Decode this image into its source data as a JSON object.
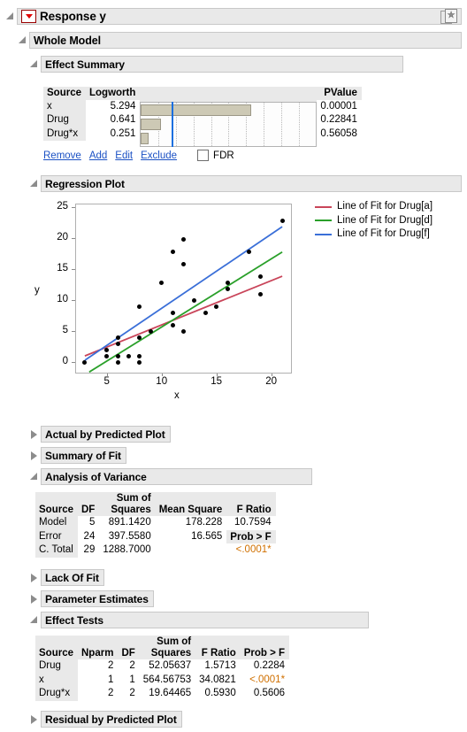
{
  "window": {
    "title": "Response y",
    "menu_icon": "red-triangle-menu-icon",
    "corner_icon": "window-layers-star-icon"
  },
  "sections": {
    "whole_model": "Whole Model",
    "effect_summary": "Effect Summary",
    "regression_plot": "Regression Plot",
    "actual_by_predicted": "Actual by Predicted Plot",
    "summary_of_fit": "Summary of Fit",
    "analysis_of_variance": "Analysis of Variance",
    "lack_of_fit": "Lack Of Fit",
    "parameter_estimates": "Parameter Estimates",
    "effect_tests": "Effect Tests",
    "residual_by_predicted": "Residual by Predicted Plot"
  },
  "effect_summary": {
    "headers": [
      "Source",
      "Logworth",
      "PValue"
    ],
    "rows": [
      {
        "source": "x",
        "logworth": "5.294",
        "pvalue": "0.00001",
        "bar_frac": 0.63
      },
      {
        "source": "Drug",
        "logworth": "0.641",
        "pvalue": "0.22841",
        "bar_frac": 0.115
      },
      {
        "source": "Drug*x",
        "logworth": "0.251",
        "pvalue": "0.56058",
        "bar_frac": 0.045
      }
    ],
    "reference_line_frac": 0.176,
    "links": [
      "Remove",
      "Add",
      "Edit",
      "Exclude"
    ],
    "fdr_label": "FDR",
    "fdr_checked": false,
    "bar_color": "#cdc9b5",
    "ref_color": "#1a6fe0"
  },
  "chart_data": {
    "type": "scatter",
    "title": "Regression Plot",
    "xlabel": "x",
    "ylabel": "y",
    "xlim": [
      2.2,
      21.8
    ],
    "ylim": [
      -1.6,
      25.6
    ],
    "xticks": [
      5,
      10,
      15,
      20
    ],
    "yticks": [
      0,
      5,
      10,
      15,
      20,
      25
    ],
    "grid": false,
    "legend_position": "right",
    "points": [
      [
        3,
        0
      ],
      [
        5,
        2
      ],
      [
        5,
        1
      ],
      [
        6,
        4
      ],
      [
        6,
        3
      ],
      [
        6,
        1
      ],
      [
        6,
        0
      ],
      [
        7,
        1
      ],
      [
        8,
        1
      ],
      [
        8,
        0
      ],
      [
        8,
        4
      ],
      [
        8,
        9
      ],
      [
        9,
        5
      ],
      [
        10,
        13
      ],
      [
        11,
        18
      ],
      [
        11,
        8
      ],
      [
        11,
        6
      ],
      [
        12,
        20
      ],
      [
        12,
        16
      ],
      [
        12,
        5
      ],
      [
        13,
        10
      ],
      [
        14,
        8
      ],
      [
        15,
        9
      ],
      [
        16,
        13
      ],
      [
        16,
        12
      ],
      [
        18,
        18
      ],
      [
        19,
        14
      ],
      [
        19,
        11
      ],
      [
        21,
        23
      ]
    ],
    "series": [
      {
        "name": "Line of Fit for Drug[a]",
        "color": "#c9455a",
        "type": "line",
        "x": [
          3.0,
          21.0
        ],
        "y": [
          1.1,
          14.0
        ]
      },
      {
        "name": "Line of Fit for Drug[d]",
        "color": "#2aa02a",
        "type": "line",
        "x": [
          3.4,
          21.0
        ],
        "y": [
          -1.5,
          17.9
        ]
      },
      {
        "name": "Line of Fit for Drug[f]",
        "color": "#3a6fd8",
        "type": "line",
        "x": [
          3.0,
          21.0
        ],
        "y": [
          0.4,
          22.0
        ]
      }
    ]
  },
  "anova": {
    "headers": [
      "Source",
      "DF",
      "Sum of\nSquares",
      "Mean Square",
      "F Ratio"
    ],
    "rows": [
      {
        "source": "Model",
        "df": "5",
        "ss": "891.1420",
        "ms": "178.228",
        "f": "10.7594",
        "f_orange": false
      },
      {
        "source": "Error",
        "df": "24",
        "ss": "397.5580",
        "ms": "16.565",
        "f": "Prob > F",
        "f_header": true
      },
      {
        "source": "C. Total",
        "df": "29",
        "ss": "1288.7000",
        "ms": "",
        "f": "<.0001*",
        "f_orange": true
      }
    ]
  },
  "effect_tests": {
    "headers": [
      "Source",
      "Nparm",
      "DF",
      "Sum of\nSquares",
      "F Ratio",
      "Prob > F"
    ],
    "rows": [
      {
        "source": "Drug",
        "nparm": "2",
        "df": "2",
        "ss": "52.05637",
        "f": "1.5713",
        "p": "0.2284",
        "p_orange": false
      },
      {
        "source": "x",
        "nparm": "1",
        "df": "1",
        "ss": "564.56753",
        "f": "34.0821",
        "p": "<.0001*",
        "p_orange": true
      },
      {
        "source": "Drug*x",
        "nparm": "2",
        "df": "2",
        "ss": "19.64465",
        "f": "0.5930",
        "p": "0.5606",
        "p_orange": false
      }
    ]
  }
}
